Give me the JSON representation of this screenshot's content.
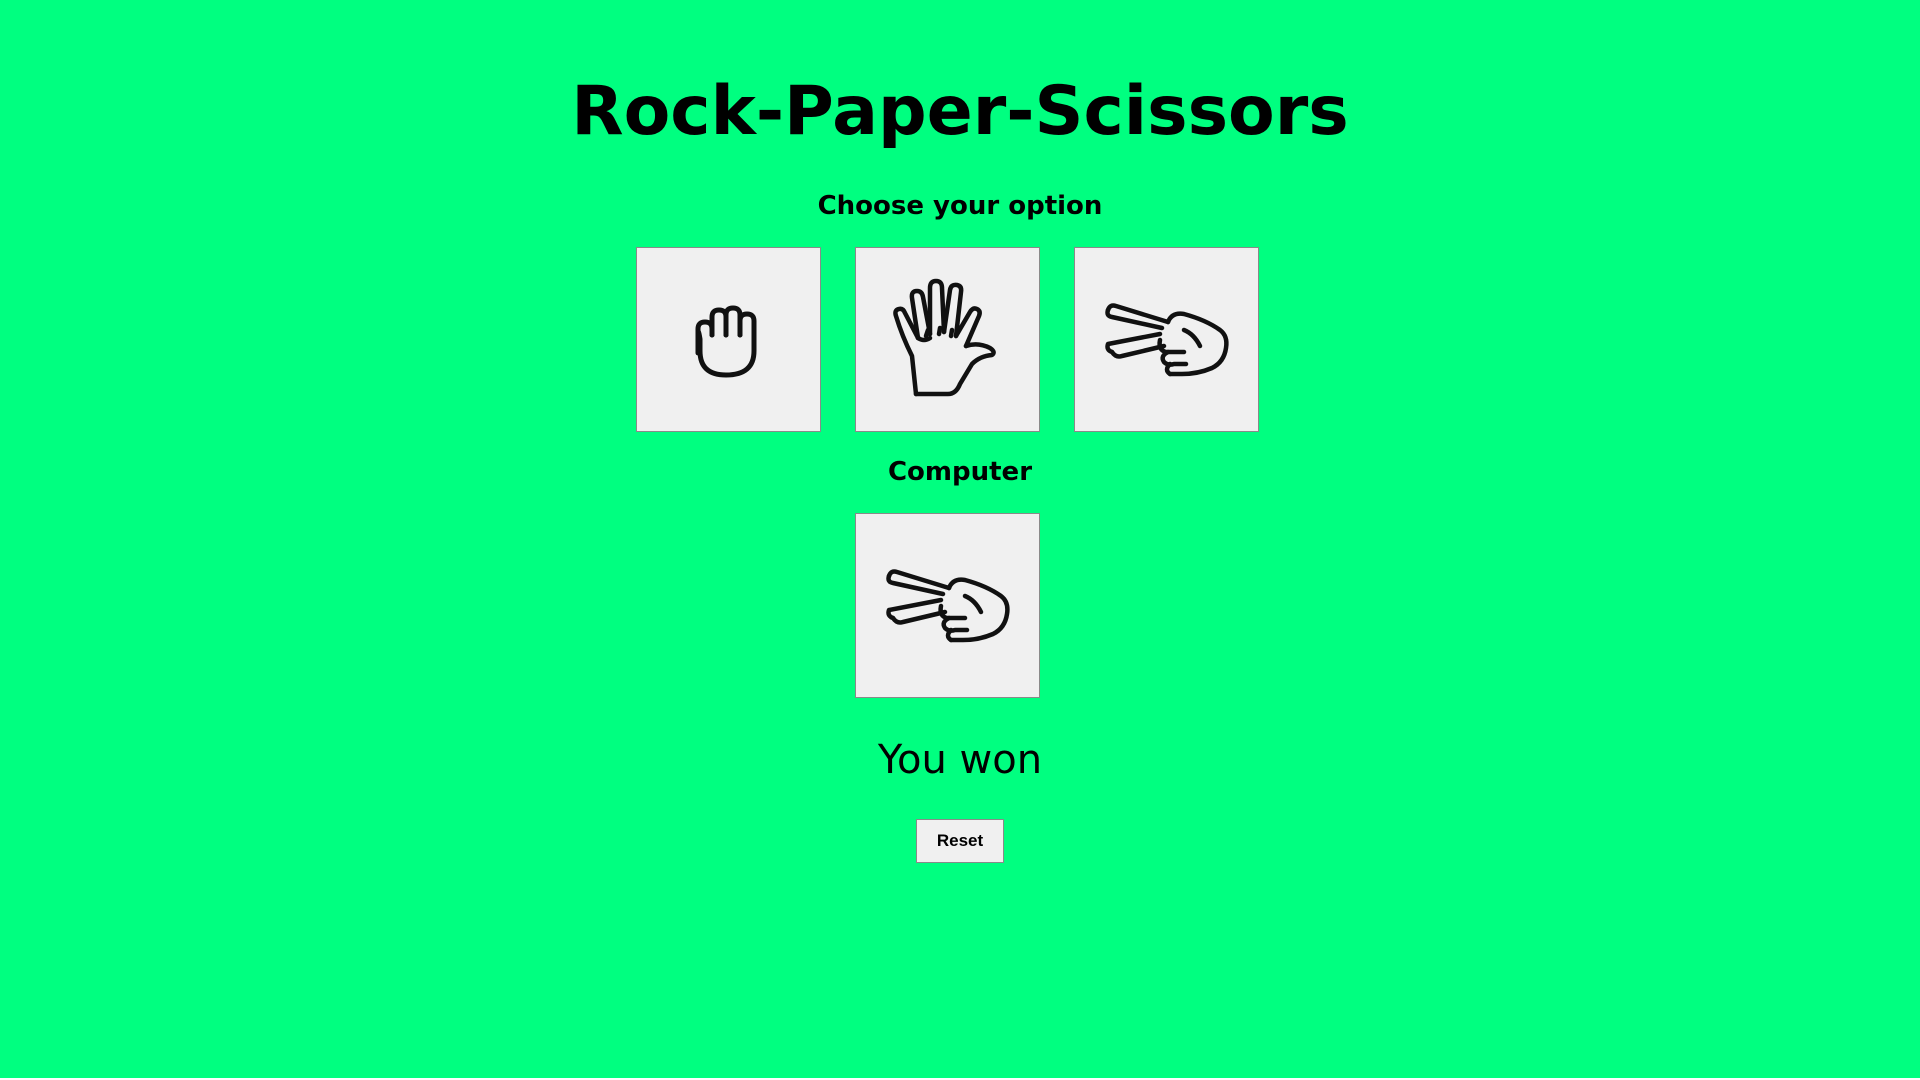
{
  "title": "Rock-Paper-Scissors",
  "choose_heading": "Choose your option",
  "options": [
    {
      "id": "rock",
      "icon": "rock-hand-icon"
    },
    {
      "id": "paper",
      "icon": "paper-hand-icon"
    },
    {
      "id": "scissors",
      "icon": "scissors-hand-icon"
    }
  ],
  "computer_heading": "Computer",
  "computer_choice": {
    "id": "scissors",
    "icon": "scissors-hand-icon"
  },
  "result_text": "You won",
  "reset_label": "Reset",
  "colors": {
    "background": "#00ff80",
    "tile": "#f0f0f0",
    "tile_border": "#8a8a8a"
  }
}
